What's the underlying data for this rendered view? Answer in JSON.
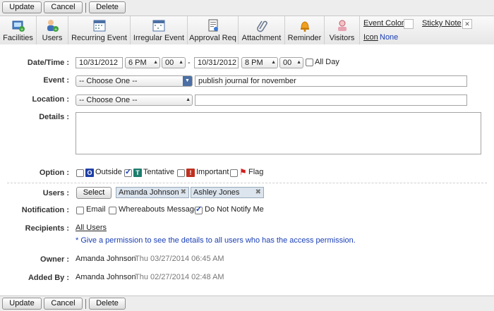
{
  "actions": {
    "update": "Update",
    "cancel": "Cancel",
    "delete": "Delete"
  },
  "toolbar": {
    "items": [
      {
        "label": "Facilities"
      },
      {
        "label": "Users"
      },
      {
        "label": "Recurring Event"
      },
      {
        "label": "Irregular Event"
      },
      {
        "label": "Approval Req"
      },
      {
        "label": "Attachment"
      },
      {
        "label": "Reminder"
      },
      {
        "label": "Visitors"
      }
    ],
    "event_color": "Event Color",
    "sticky_note": "Sticky Note",
    "icon_label": "Icon",
    "icon_value": "None"
  },
  "form": {
    "datetime": {
      "label": "Date/Time :",
      "start_date": "10/31/2012",
      "start_hour": "6 PM",
      "start_min": "00",
      "dash": "-",
      "end_date": "10/31/2012",
      "end_hour": "8 PM",
      "end_min": "00",
      "allday": "All Day"
    },
    "event": {
      "label": "Event :",
      "select": "-- Choose One --",
      "title": "publish journal for november"
    },
    "location": {
      "label": "Location :",
      "select": "-- Choose One --",
      "value": ""
    },
    "details": {
      "label": "Details :",
      "value": ""
    },
    "option": {
      "label": "Option :",
      "outside": "Outside",
      "outside_badge": "O",
      "tentative": "Tentative",
      "tentative_badge": "T",
      "important": "Important",
      "important_badge": "!",
      "flag": "Flag"
    },
    "users": {
      "label": "Users :",
      "select_btn": "Select",
      "list": [
        "Amanda Johnson",
        "Ashley Jones"
      ]
    },
    "notification": {
      "label": "Notification :",
      "email": "Email",
      "whereabouts": "Whereabouts Message",
      "donotnotify": "Do Not Notify Me"
    },
    "recipients": {
      "label": "Recipients :",
      "link": "All Users",
      "note": "* Give a permission to see the details to all users who has the access permission."
    },
    "owner": {
      "label": "Owner :",
      "name": "Amanda Johnson",
      "time": "Thu 03/27/2014 06:45 AM"
    },
    "added_by": {
      "label": "Added By :",
      "name": "Amanda Johnson",
      "time": "Thu 02/27/2014 02:48 AM"
    }
  },
  "colors": {
    "link": "#1a3fb5",
    "outside": "#1e3fa8",
    "tentative": "#1d7d6e",
    "important": "#c0301e"
  }
}
